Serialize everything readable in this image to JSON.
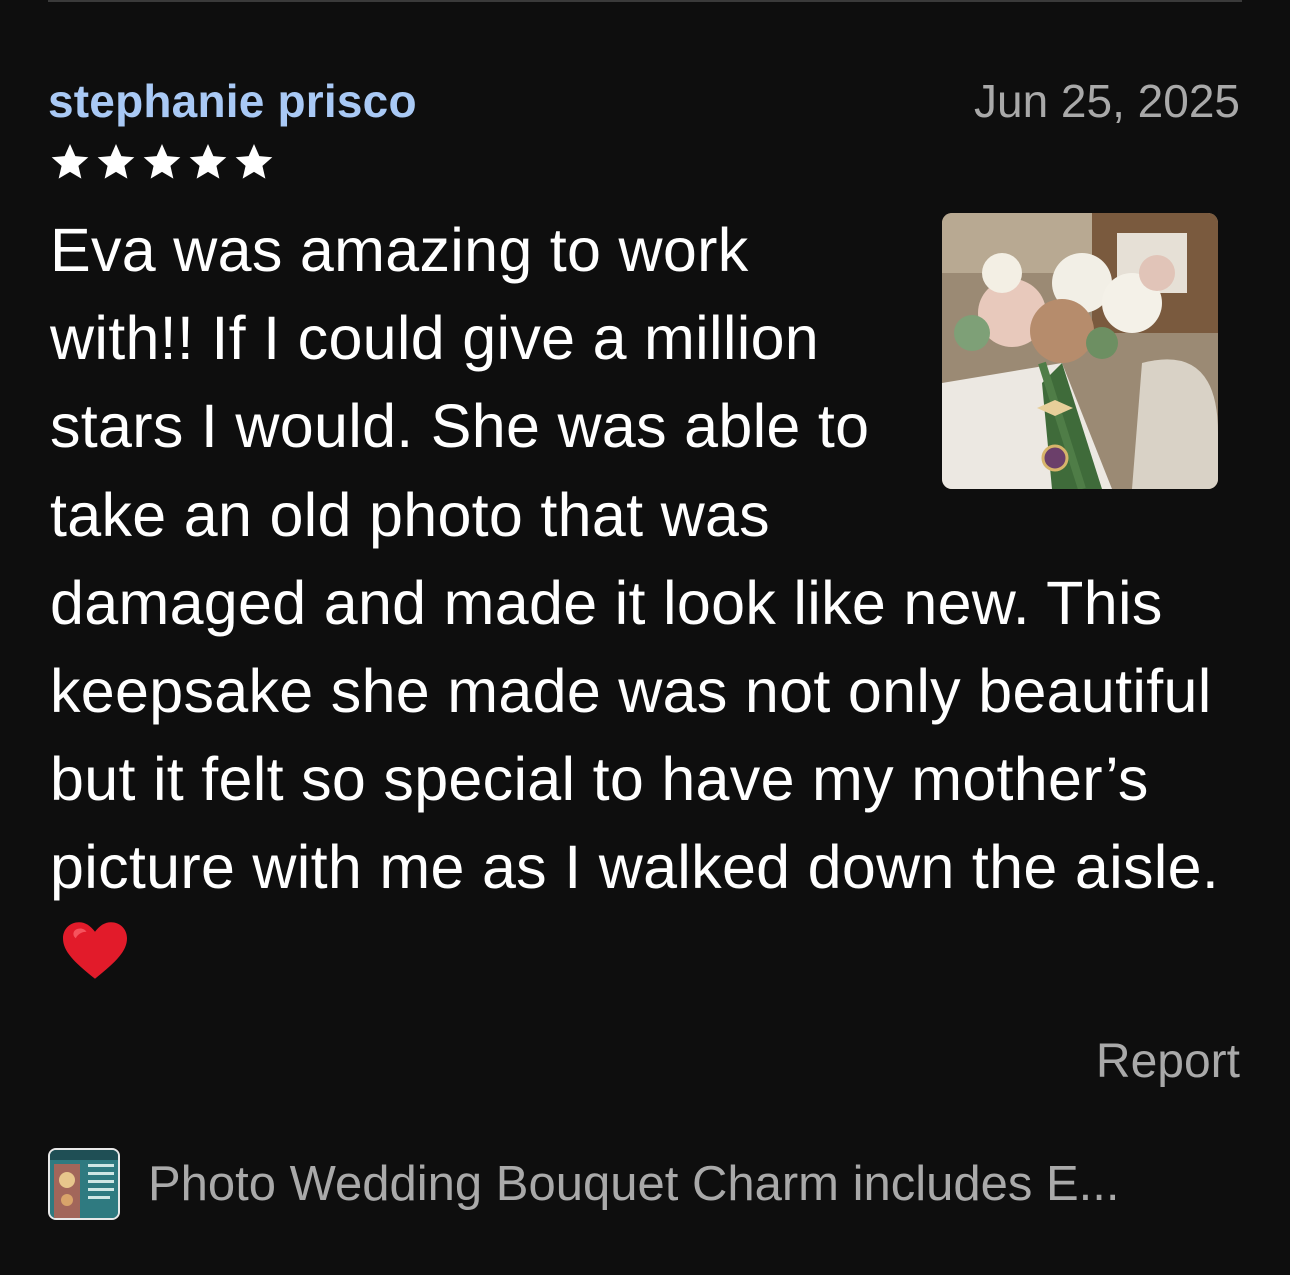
{
  "review": {
    "reviewer_name": "stephanie prisco",
    "date": "Jun 25, 2025",
    "rating": 5,
    "rating_max": 5,
    "text": "Eva was amazing to work with!! If I could give a million stars I would. She was able to take an old photo that was damaged and made it look like new. This keepsake she made was not only beautiful but it felt so special to have my mother’s picture with me as I walked down the aisle.",
    "text_emoji": "heart-emoji",
    "photo_icon": "review-photo",
    "report_label": "Report"
  },
  "product": {
    "title": "Photo Wedding Bouquet Charm includes E...",
    "thumb_icon": "product-thumbnail"
  },
  "colors": {
    "background": "#0e0e0e",
    "reviewer_name": "#a9c9f5",
    "muted_text": "#a9a9a9",
    "body_text": "#ffffff",
    "star": "#ffffff",
    "heart": "#e21b2a"
  }
}
